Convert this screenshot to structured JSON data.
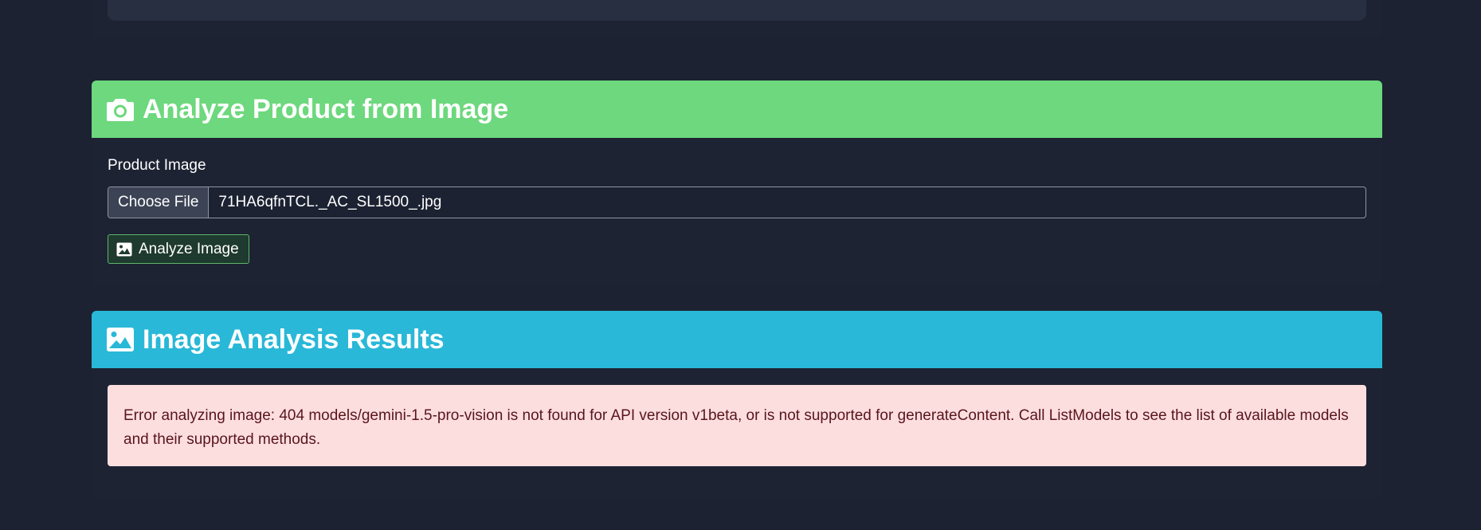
{
  "upload_card": {
    "title": "Analyze Product from Image",
    "header_icon": "camera-icon",
    "header_color": "#6dd87d",
    "field_label": "Product Image",
    "choose_file_label": "Choose File",
    "selected_file": "71HA6qfnTCL._AC_SL1500_.jpg",
    "analyze_button_label": "Analyze Image",
    "analyze_button_icon": "image-icon"
  },
  "results_card": {
    "title": "Image Analysis Results",
    "header_icon": "image-icon",
    "header_color": "#29b8d8",
    "error_message": "Error analyzing image: 404 models/gemini-1.5-pro-vision is not found for API version v1beta, or is not supported for generateContent. Call ListModels to see the list of available models and their supported methods."
  }
}
